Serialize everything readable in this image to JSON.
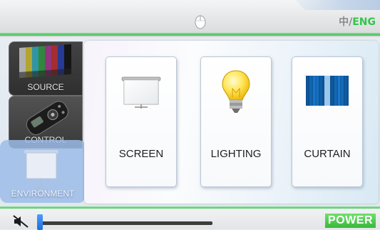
{
  "header": {
    "lang_zh": "中",
    "lang_sep": "/",
    "lang_en": "ENG",
    "mouse_icon": "mouse-icon"
  },
  "sidebar": {
    "items": [
      {
        "label": "SOURCE",
        "icon": "color-bars-icon"
      },
      {
        "label": "CONTROL",
        "icon": "remote-control-icon"
      },
      {
        "label": "ENVIRONMENT",
        "icon": "projector-screen-icon",
        "selected": true
      }
    ]
  },
  "main": {
    "cards": [
      {
        "label": "SCREEN",
        "icon": "projector-screen-icon"
      },
      {
        "label": "LIGHTING",
        "icon": "light-bulb-icon"
      },
      {
        "label": "CURTAIN",
        "icon": "curtain-icon"
      }
    ]
  },
  "footer": {
    "power_label": "POWER",
    "mute_icon": "mute-speaker-icon",
    "volume_level": 0.0
  },
  "colors": {
    "accent_green": "#32c64a",
    "selected_blue": "#9cbce7",
    "volume_thumb": "#1e6fdc"
  }
}
